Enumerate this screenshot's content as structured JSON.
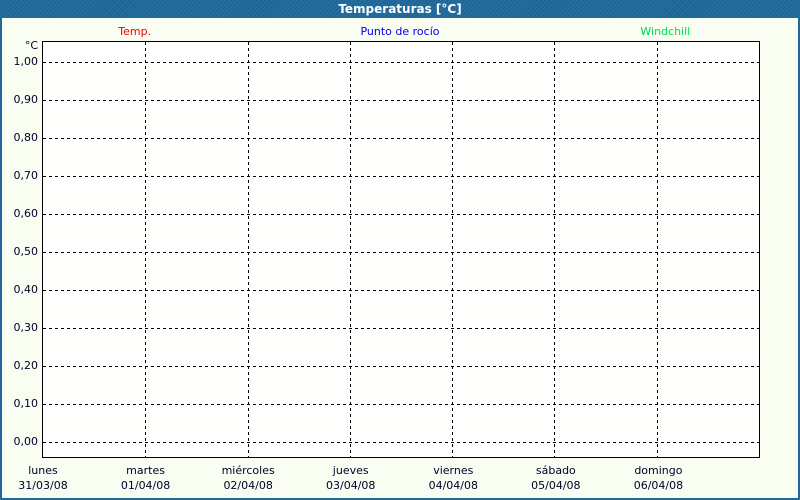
{
  "window": {
    "title": "Temperaturas [°C]",
    "colors": {
      "titlebar": "#1e6a9c",
      "border": "#1e6a9c",
      "background": "#fafdf2",
      "plot_background": "#fffffe",
      "grid": "#000000",
      "tick_text": "#000028"
    }
  },
  "legend": {
    "items": [
      {
        "key": "temp",
        "label": "Temp.",
        "color": "#f40000"
      },
      {
        "key": "dew-point",
        "label": "Punto de rocío",
        "color": "#0000e8"
      },
      {
        "key": "windchill",
        "label": "Windchill",
        "color": "#00dd4c"
      }
    ]
  },
  "chart_data": {
    "type": "line",
    "title": "Temperaturas [°C]",
    "ylabel": "°C",
    "ylim": [
      0,
      1
    ],
    "y_tick_step": 0.1,
    "y_ticks": [
      "1,00",
      "0,90",
      "0,80",
      "0,70",
      "0,60",
      "0,50",
      "0,40",
      "0,30",
      "0,20",
      "0,10",
      "0,00"
    ],
    "grid": "dashed",
    "legend_position": "top",
    "x_categories": [
      {
        "day": "lunes",
        "date": "31/03/08"
      },
      {
        "day": "martes",
        "date": "01/04/08"
      },
      {
        "day": "miércoles",
        "date": "02/04/08"
      },
      {
        "day": "jueves",
        "date": "03/04/08"
      },
      {
        "day": "viernes",
        "date": "04/04/08"
      },
      {
        "day": "sábado",
        "date": "05/04/08"
      },
      {
        "day": "domingo",
        "date": "06/04/08"
      }
    ],
    "series": [
      {
        "name": "Temp.",
        "color": "#f40000",
        "values": []
      },
      {
        "name": "Punto de rocío",
        "color": "#0000e8",
        "values": []
      },
      {
        "name": "Windchill",
        "color": "#00dd4c",
        "values": []
      }
    ]
  }
}
